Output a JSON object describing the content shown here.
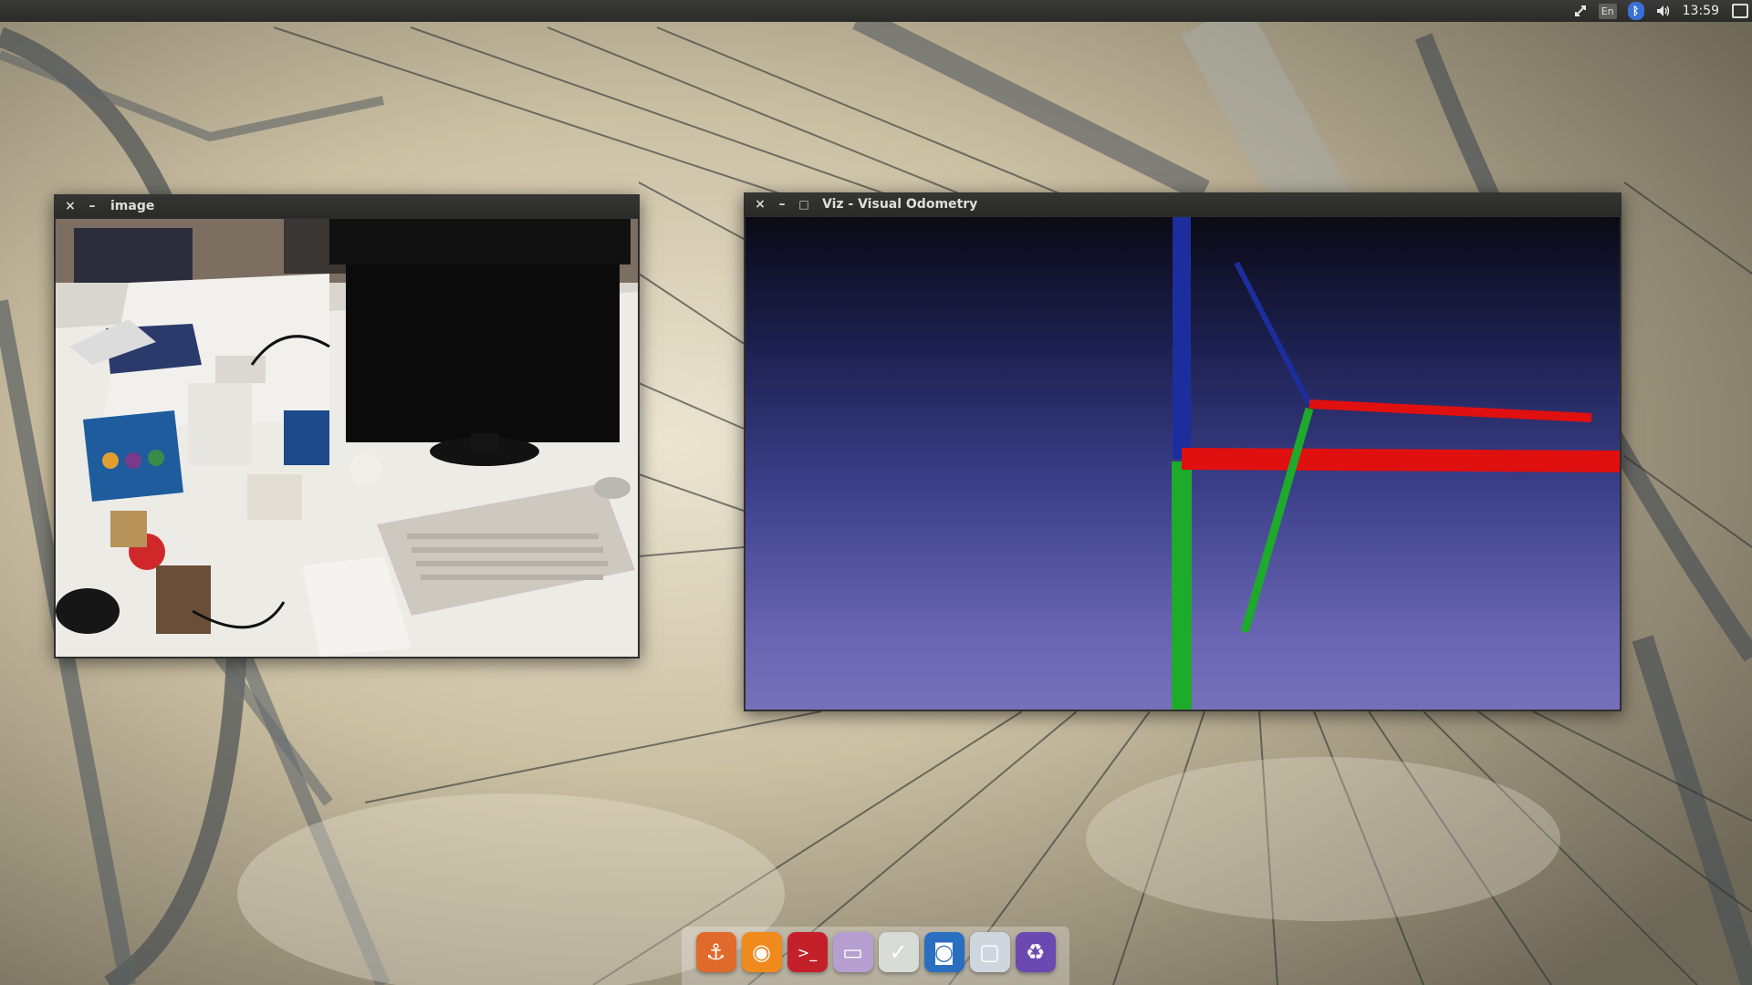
{
  "top_panel": {
    "lang": "En",
    "bluetooth_glyph": "ᛒ",
    "time": "13:59",
    "icons": [
      "network-icon",
      "keyboard-layout-icon",
      "bluetooth-icon",
      "volume-icon",
      "clock",
      "session-icon"
    ]
  },
  "image_window": {
    "close": "×",
    "minimize": "–",
    "title": "image"
  },
  "viz_window": {
    "close": "×",
    "minimize": "–",
    "maximize": "□",
    "title": "Viz - Visual Odometry"
  },
  "dock": {
    "items": [
      {
        "name": "anchor-launcher-icon",
        "glyph": "⚓",
        "color": "#e06a2c"
      },
      {
        "name": "firefox-icon",
        "glyph": "◉",
        "color": "#f08a1c"
      },
      {
        "name": "terminal-icon",
        "glyph": ">_",
        "color": "#c4202a"
      },
      {
        "name": "files-icon",
        "glyph": "▭",
        "color": "#b69fd0"
      },
      {
        "name": "software-updater-icon",
        "glyph": "✓",
        "color": "#d8dcd6"
      },
      {
        "name": "screenshot-icon",
        "glyph": "◙",
        "color": "#2a6fbf"
      },
      {
        "name": "window-icon",
        "glyph": "▢",
        "color": "#cfd6de"
      },
      {
        "name": "trash-icon",
        "glyph": "♻",
        "color": "#6a4ab0"
      }
    ]
  },
  "colors": {
    "axis_x": "#e01010",
    "axis_y": "#1eaa2a",
    "axis_z": "#1c2e9e"
  }
}
